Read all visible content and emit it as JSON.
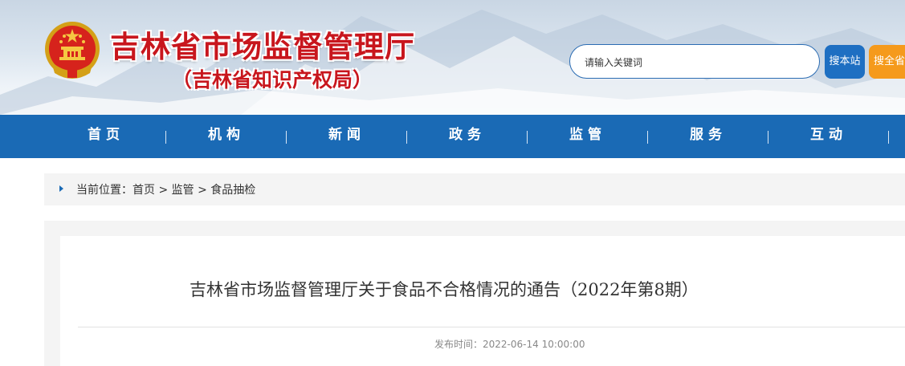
{
  "header": {
    "site_title": "吉林省市场监督管理厅",
    "site_subtitle": "（吉林省知识产权局）",
    "emblem_icon": "national-emblem-icon"
  },
  "search": {
    "placeholder": "请输入关键词",
    "site_button": "搜本站",
    "province_button": "搜全省"
  },
  "nav": {
    "items": [
      {
        "label": "首页"
      },
      {
        "label": "机构"
      },
      {
        "label": "新闻"
      },
      {
        "label": "政务"
      },
      {
        "label": "监管"
      },
      {
        "label": "服务"
      },
      {
        "label": "互动"
      }
    ]
  },
  "breadcrumb": {
    "prefix": "当前位置：",
    "home": "首页",
    "sep1": " > ",
    "level1": "监管",
    "sep2": " > ",
    "level2": "食品抽检"
  },
  "article": {
    "title": "吉林省市场监督管理厅关于食品不合格情况的通告（2022年第8期）",
    "publish_label": "发布时间：",
    "publish_time": "2022-06-14 10:00:00"
  },
  "colors": {
    "brand_red": "#c8161d",
    "nav_blue": "#1a6ab5",
    "search_blue": "#1e6fc2",
    "search_orange": "#f59a1c"
  }
}
